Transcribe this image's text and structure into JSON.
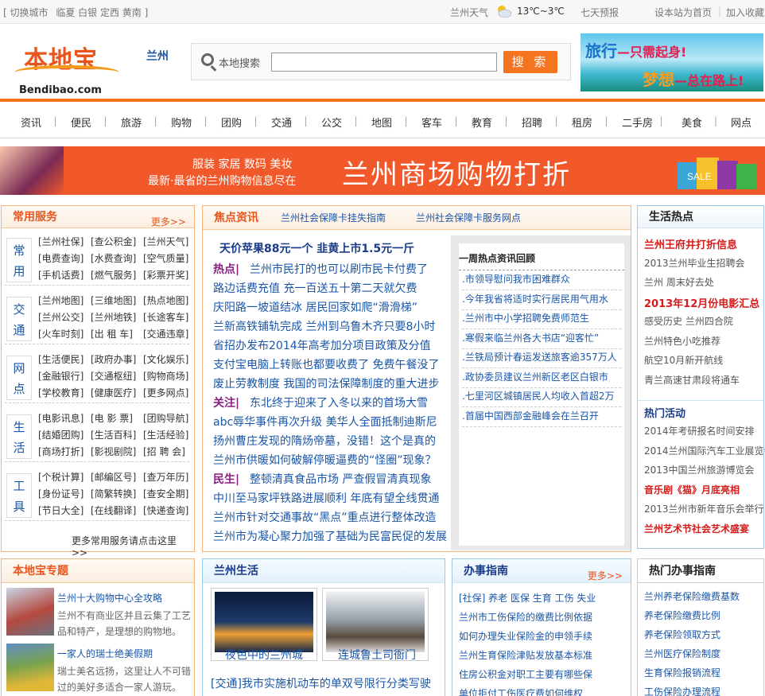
{
  "topbar": {
    "switch_city": "[ 切换城市",
    "cities": "临夏 白银 定西 黄南 ]",
    "weather_label": "兰州天气",
    "temp": "13℃~3℃",
    "forecast": "七天预报",
    "set_home": "设本站为首页",
    "bookmark": "加入收藏"
  },
  "header": {
    "logo_cn": "本地宝",
    "logo_en": "Bendibao.com",
    "city": "兰州",
    "search_label": "本地搜索",
    "search_button": "搜 索",
    "search_value": "",
    "ad_line1_a": "旅行",
    "ad_line1_b": "—只需起身!",
    "ad_line2_a": "梦想",
    "ad_line2_b": "—总在路上!"
  },
  "nav": [
    "资讯",
    "便民",
    "旅游",
    "购物",
    "团购",
    "交通",
    "公交",
    "地图",
    "客车",
    "教育",
    "招聘",
    "租房",
    "二手房",
    "美食",
    "网点"
  ],
  "banner": {
    "line1": "服装  家居  数码  美妆",
    "line2": "最新·最省的兰州购物信息尽在",
    "title": "兰州商场购物打折",
    "sale": "SALE"
  },
  "services": {
    "title": "常用服务",
    "more": "更多>>",
    "groups": [
      {
        "cat": [
          "常",
          "用"
        ],
        "links": [
          "[兰州社保]",
          "[查公积金]",
          "[兰州天气]",
          "[电费查询]",
          "[水费查询]",
          "[空气质量]",
          "[手机话费]",
          "[燃气服务]",
          "[彩票开奖]"
        ]
      },
      {
        "cat": [
          "交",
          "通"
        ],
        "links": [
          "[兰州地图]",
          "[三维地图]",
          "[热点地图]",
          "[兰州公交]",
          "[兰州地铁]",
          "[长途客车]",
          "[火车时刻]",
          "[出 租 车]",
          "[交通违章]"
        ]
      },
      {
        "cat": [
          "网",
          "点"
        ],
        "links": [
          "[生活便民]",
          "[政府办事]",
          "[文化娱乐]",
          "[金融银行]",
          "[交通枢纽]",
          "[购物商场]",
          "[学校教育]",
          "[健康医疗]",
          "[更多网点]"
        ]
      },
      {
        "cat": [
          "生",
          "活"
        ],
        "links": [
          "[电影讯息]",
          "[电 影 票]",
          "[团购导航]",
          "[结婚团购]",
          "[生活百科]",
          "[生活经验]",
          "[商场打折]",
          "[影视剧院]",
          "[招 聘 会]"
        ]
      },
      {
        "cat": [
          "工",
          "具"
        ],
        "links": [
          "[个税计算]",
          "[邮编区号]",
          "[查万年历]",
          "[身份证号]",
          "[简繁转换]",
          "[查安全期]",
          "[节日大全]",
          "[在线翻译]",
          "[快递查询]"
        ]
      }
    ],
    "footer": "更多常用服务请点击这里 >>"
  },
  "focus": {
    "title": "焦点资讯",
    "tab1": "兰州社会保障卡挂失指南",
    "tab2": "兰州社会保障卡服务网点",
    "headline": "天价苹果88元一个  韭黄上市1.5元一斤",
    "tag_hot": "热点|",
    "tag_focus": "关注|",
    "tag_people": "民生|",
    "lines": [
      "兰州市民打的也可以刷市民卡付费了",
      "路边话费充值  充一百送五十第二天就欠费",
      "庆阳路一坡道结冰  居民回家如爬“滑滑梯”",
      "兰新高铁铺轨完成  兰州到乌鲁木齐只要8小时",
      "省招办发布2014年高考加分项目政策及分值",
      "支付宝电脑上转账也都要收费了  免费午餐没了",
      "废止劳教制度  我国的司法保障制度的重大进步",
      "东北终于迎来了入冬以来的首场大雪",
      "abc辱华事件再次升级  美华人全面抵制迪斯尼",
      "扬州曹庄发现的隋炀帝墓，没错！这个是真的",
      "兰州市供暖如何破解停暖逼费的“怪圈”现象？",
      "整顿清真食品市场  严查假冒清真现象",
      "中川至马家坪铁路进展顺利  年底有望全线贯通",
      "兰州市针对交通事故“黑点”重点进行整体改造",
      "兰州市为凝心聚力加强了基础为民富民促的发展"
    ]
  },
  "weekly": {
    "title": "一周热点资讯回顾",
    "items": [
      ".市领导慰问我市困难群众",
      ".今年我省将适时实行居民用气用水",
      ".兰州市中小学招聘免费师范生",
      ".寒假来临兰州各大书店“迎客忙”",
      ".兰铁局预计春运发送旅客逾357万人",
      ".政协委员建议兰州新区老区白银市",
      ".七里河区城镇居民人均收入首超2万",
      ".首届中国西部金融峰会在兰召开"
    ]
  },
  "life_hot": {
    "title": "生活热点",
    "items": [
      "兰州王府井打折信息",
      "2013兰州毕业生招聘会",
      "兰州 周末好去处",
      "2013年12月份电影汇总",
      "感受历史 兰州四合院",
      "兰州特色小吃推荐",
      "航空10月新开航线",
      "青兰高速甘肃段将通车"
    ],
    "activity_title": "热门活动",
    "activities": [
      "2014年考研报名时间安排",
      "2014兰州国际汽车工业展览会",
      "2013中国兰州旅游博览会",
      "音乐剧《猫》月底亮相",
      "2013兰州市新年音乐会举行",
      "兰州艺术节社会艺术盛宴"
    ]
  },
  "topics": {
    "title": "本地宝专题",
    "items": [
      {
        "title": "兰州十大购物中心全攻略",
        "desc1": "兰州不有商业区并且云集了工艺",
        "desc2": "品和特产，是理想的购物地。"
      },
      {
        "title": "一家人的瑞士绝美假期",
        "desc1": "瑞士美名远扬，这里让人不可错",
        "desc2": "过的美好多适合一家人游玩。"
      }
    ]
  },
  "lanzhou_life": {
    "title": "兰州生活",
    "photo1": "夜色中的兰州城",
    "photo2": "连城鲁土司衙门",
    "news": "[交通]我市实施机动车的单双号限行分类写驶"
  },
  "guide": {
    "title": "办事指南",
    "more": "更多>>",
    "tags": "[社保]  养老  医保  生育  工伤  失业",
    "items": [
      "兰州市工伤保险的缴费比例依据",
      "如何办理失业保险金的申领手续",
      "兰州生育保险津贴发放基本标准",
      "住房公积金对职工主要有哪些保",
      "单位拒付工伤医疗费如何维权"
    ]
  },
  "hot_guide": {
    "title": "热门办事指南",
    "items": [
      "兰州养老保险缴费基数",
      "养老保险缴费比例",
      "养老保险领取方式",
      "兰州医疗保险制度",
      "生育保险报销流程",
      "工伤保险办理流程"
    ]
  },
  "colors": {
    "accent": "#f4741f",
    "link": "#1a56a8",
    "tag": "#8a1e80",
    "red": "#d41c1c"
  }
}
